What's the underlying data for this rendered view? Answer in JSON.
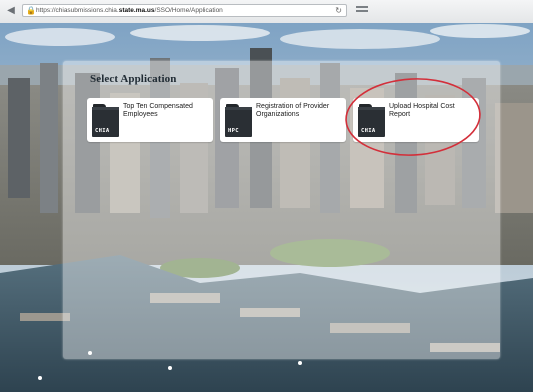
{
  "browser": {
    "url_prefix": "https://chiasubmissions.chia.",
    "url_domain": "state.ma.us",
    "url_path": "/SSO/Home/Application",
    "back_icon": "back-arrow-icon",
    "lock_icon": "lock-icon",
    "reload_icon": "reload-icon"
  },
  "panel": {
    "title": "Select Application"
  },
  "applications": [
    {
      "label_lines": [
        "Top Ten Compensated",
        "Employees"
      ],
      "code": "CHIA",
      "highlighted": false
    },
    {
      "label_lines": [
        "Registration of Provider",
        "Organizations"
      ],
      "code": "HPC",
      "highlighted": false
    },
    {
      "label_lines": [
        "Upload Hospital Cost",
        "Report"
      ],
      "code": "CHIA",
      "highlighted": true
    }
  ],
  "colors": {
    "annotation": "#d32f3a",
    "folder": "#2a2f34",
    "panel_overlay": "rgba(255,255,255,0.42)"
  }
}
